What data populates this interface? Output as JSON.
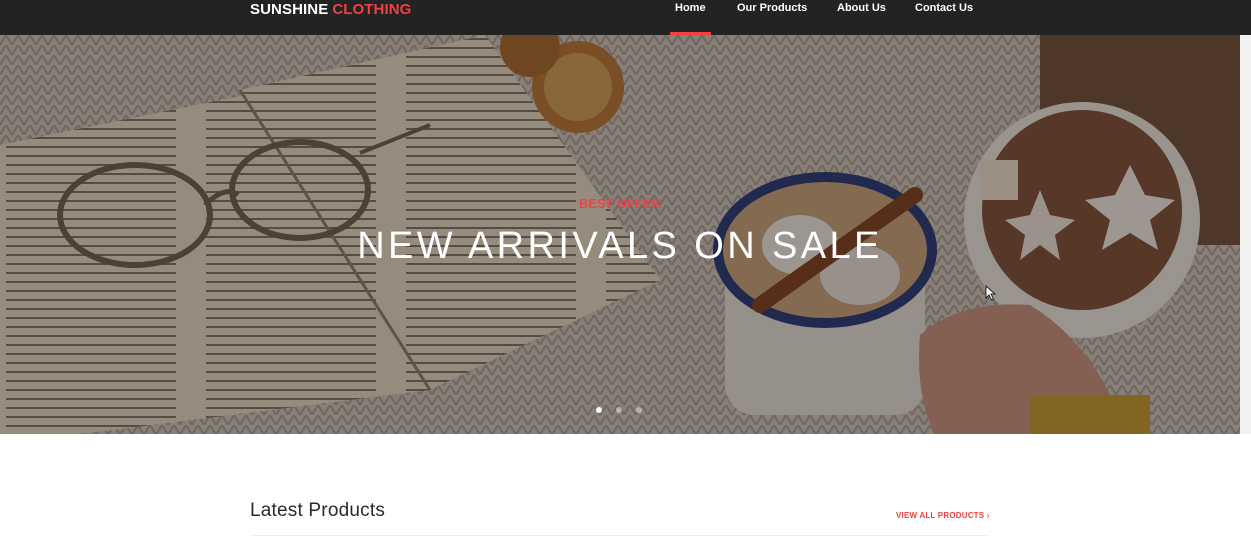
{
  "header": {
    "logo_main": "SUNSHINE",
    "logo_accent": "CLOTHING",
    "nav": [
      {
        "label": "Home",
        "active": true
      },
      {
        "label": "Our Products",
        "active": false
      },
      {
        "label": "About Us",
        "active": false
      },
      {
        "label": "Contact Us",
        "active": false
      }
    ]
  },
  "hero": {
    "offer_label": "BEST OFFER",
    "title": "NEW ARRIVALS ON SALE",
    "slides_total": 3,
    "active_slide": 1
  },
  "latest_products": {
    "title": "Latest Products",
    "view_all_label": "VIEW ALL PRODUCTS ›"
  },
  "colors": {
    "accent": "#f33f3f",
    "header_bg": "#232323"
  }
}
